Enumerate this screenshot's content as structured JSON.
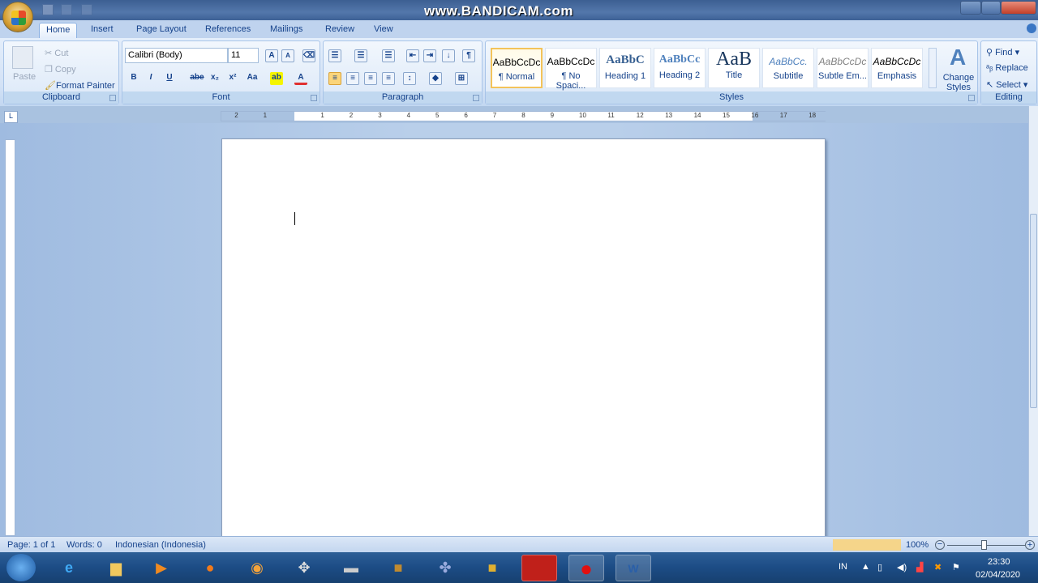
{
  "window": {
    "watermark": "www.BANDICAM.com"
  },
  "tabs": [
    "Home",
    "Insert",
    "Page Layout",
    "References",
    "Mailings",
    "Review",
    "View"
  ],
  "clipboard": {
    "label": "Clipboard",
    "paste": "Paste",
    "cut": "Cut",
    "copy": "Copy",
    "format_painter": "Format Painter"
  },
  "font": {
    "label": "Font",
    "family": "Calibri (Body)",
    "size": "11",
    "bold": "B",
    "italic": "I",
    "underline": "U",
    "strike": "abe",
    "sub": "x₂",
    "sup": "x²",
    "case": "Aa",
    "grow": "A",
    "shrink": "A",
    "font_color_hex": "#e03030",
    "highlight_hex": "#f5f500"
  },
  "paragraph": {
    "label": "Paragraph",
    "pilcrow": "¶"
  },
  "styles": {
    "label": "Styles",
    "items": [
      {
        "sample": "AaBbCcDc",
        "name": "¶ Normal"
      },
      {
        "sample": "AaBbCcDc",
        "name": "¶ No Spaci..."
      },
      {
        "sample": "AaBbC",
        "name": "Heading 1"
      },
      {
        "sample": "AaBbCc",
        "name": "Heading 2"
      },
      {
        "sample": "AaB",
        "name": "Title"
      },
      {
        "sample": "AaBbCc.",
        "name": "Subtitle"
      },
      {
        "sample": "AaBbCcDc",
        "name": "Subtle Em..."
      },
      {
        "sample": "AaBbCcDc",
        "name": "Emphasis"
      }
    ],
    "change_styles": "Change Styles"
  },
  "editing": {
    "label": "Editing",
    "find": "Find",
    "replace": "Replace",
    "select": "Select"
  },
  "ruler": [
    "2",
    "1",
    "1",
    "2",
    "3",
    "4",
    "5",
    "6",
    "7",
    "8",
    "9",
    "10",
    "11",
    "12",
    "13",
    "14",
    "15",
    "16",
    "17",
    "18"
  ],
  "status": {
    "page": "Page: 1 of 1",
    "words": "Words: 0",
    "language": "Indonesian (Indonesia)",
    "zoom": "100%"
  },
  "taskbar": {
    "lang": "IN",
    "time": "23:30",
    "date": "02/04/2020"
  }
}
